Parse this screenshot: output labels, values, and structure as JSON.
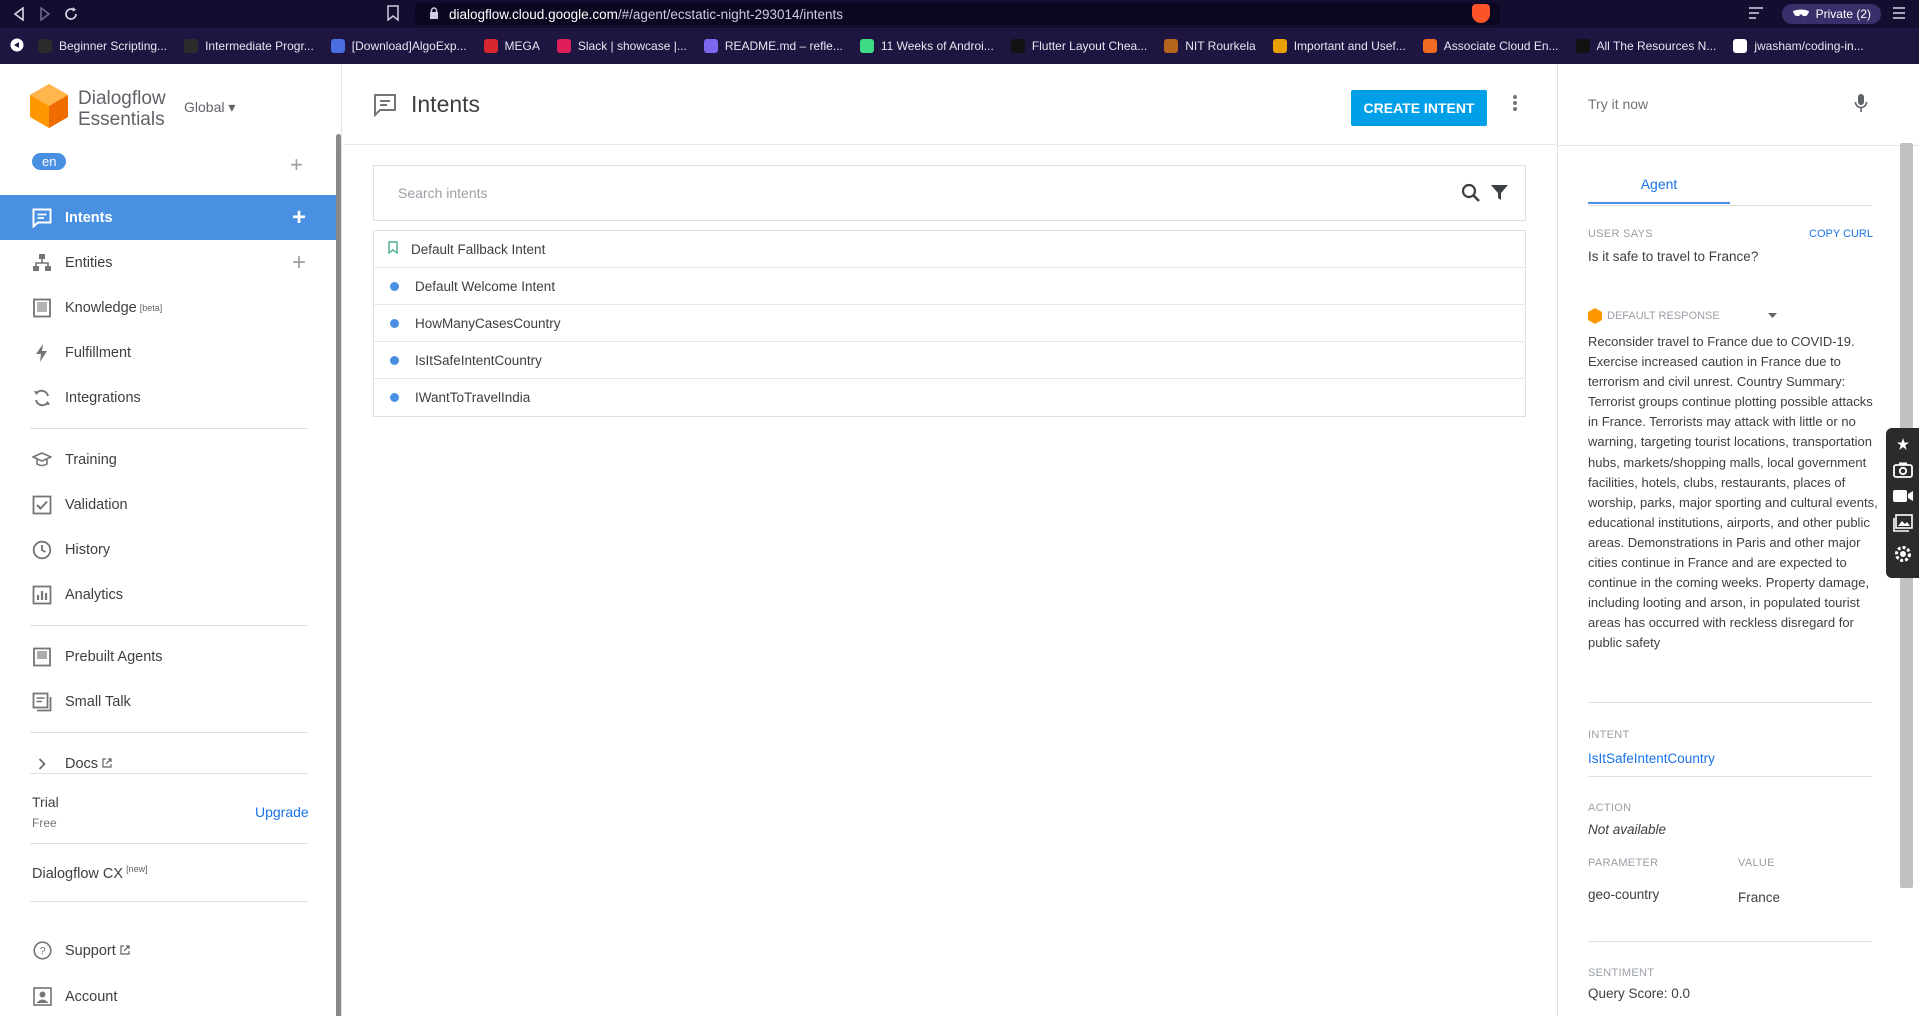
{
  "browser": {
    "url_domain": "dialogflow.cloud.google.com",
    "url_path": "/#/agent/ecstatic-night-293014/intents",
    "private_label": "Private (2)",
    "bookmarks": [
      {
        "label": "Beginner Scripting...",
        "color": "#2b2b2b"
      },
      {
        "label": "Intermediate Progr...",
        "color": "#2b2b2b"
      },
      {
        "label": "[Download]AlgoExp...",
        "color": "#4a6ee0"
      },
      {
        "label": "MEGA",
        "color": "#d9272e"
      },
      {
        "label": "Slack | showcase |...",
        "color": "#e01e5a"
      },
      {
        "label": "README.md – refle...",
        "color": "#7b68ee"
      },
      {
        "label": "11 Weeks of Androi...",
        "color": "#3ddc84"
      },
      {
        "label": "Flutter Layout Chea...",
        "color": "#111111"
      },
      {
        "label": "NIT Rourkela",
        "color": "#b5651d"
      },
      {
        "label": "Important and Usef...",
        "color": "#e6a100"
      },
      {
        "label": "Associate Cloud En...",
        "color": "#f26b21"
      },
      {
        "label": "All The Resources N...",
        "color": "#111111"
      },
      {
        "label": "jwasham/coding-in...",
        "color": "#ffffff"
      }
    ]
  },
  "sidebar": {
    "brand_line1": "Dialogflow",
    "brand_line2": "Essentials",
    "region": "Global ▾",
    "language": "en",
    "nav": [
      {
        "label": "Intents",
        "icon": "chat-bubble-icon",
        "active": true
      },
      {
        "label": "Entities",
        "icon": "entities-icon"
      },
      {
        "label": "Knowledge",
        "icon": "book-icon",
        "sup": "[beta]"
      },
      {
        "label": "Fulfillment",
        "icon": "bolt-icon"
      },
      {
        "label": "Integrations",
        "icon": "integrations-icon"
      }
    ],
    "nav2": [
      {
        "label": "Training",
        "icon": "graduation-cap-icon"
      },
      {
        "label": "Validation",
        "icon": "checkbox-icon"
      },
      {
        "label": "History",
        "icon": "clock-icon"
      },
      {
        "label": "Analytics",
        "icon": "bar-chart-icon"
      }
    ],
    "nav3": [
      {
        "label": "Prebuilt Agents",
        "icon": "prebuilt-icon"
      },
      {
        "label": "Small Talk",
        "icon": "small-talk-icon"
      }
    ],
    "docs": "Docs",
    "trial": "Trial",
    "trial_sub": "Free",
    "upgrade": "Upgrade",
    "cx": "Dialogflow CX",
    "cx_sup": "[new]",
    "support": "Support",
    "account": "Account"
  },
  "main": {
    "title": "Intents",
    "create_button": "CREATE INTENT",
    "search_placeholder": "Search intents",
    "intents": [
      {
        "name": "Default Fallback Intent",
        "marker": "bookmark"
      },
      {
        "name": "Default Welcome Intent",
        "marker": "dot"
      },
      {
        "name": "HowManyCasesCountry",
        "marker": "dot"
      },
      {
        "name": "IsItSafeIntentCountry",
        "marker": "dot"
      },
      {
        "name": "IWantToTravelIndia",
        "marker": "dot"
      }
    ]
  },
  "panel": {
    "try_placeholder": "Try it now",
    "tab": "Agent",
    "user_says_label": "USER SAYS",
    "copy_curl": "COPY CURL",
    "user_says": "Is it safe to travel to France?",
    "response_label": "DEFAULT RESPONSE",
    "response": "Reconsider travel to France due to COVID-19. Exercise increased caution in France due to terrorism and civil unrest. Country Summary:  Terrorist groups continue plotting possible attacks in France. Terrorists may attack with little or no warning, targeting tourist locations, transportation hubs, markets/shopping malls, local government facilities, hotels, clubs, restaurants, places of worship, parks, major sporting and cultural events, educational institutions, airports, and other public areas. Demonstrations in Paris and other major cities continue in France and are expected to continue in the coming weeks. Property damage, including looting and arson, in populated tourist areas has occurred with reckless disregard for public safety",
    "intent_label": "INTENT",
    "intent_value": "IsItSafeIntentCountry",
    "action_label": "ACTION",
    "action_value": "Not available",
    "parameter_label": "PARAMETER",
    "value_label": "VALUE",
    "parameter": "geo-country",
    "value": "France",
    "sentiment_label": "SENTIMENT",
    "query_score": "Query Score: 0.0"
  }
}
